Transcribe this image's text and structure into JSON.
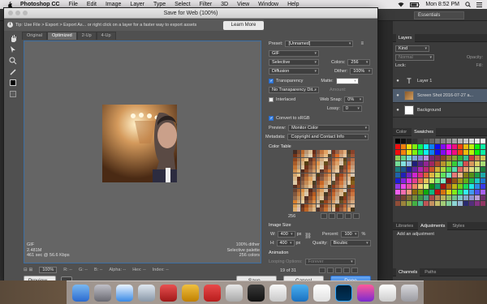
{
  "menubar": {
    "app": "Photoshop CC",
    "items": [
      "File",
      "Edit",
      "Image",
      "Layer",
      "Type",
      "Select",
      "Filter",
      "3D",
      "View",
      "Window",
      "Help"
    ],
    "clock": "Mon 8:52 PM",
    "icons": [
      "wifi-icon",
      "battery-icon",
      "search-icon",
      "menu-icon"
    ]
  },
  "workspace": {
    "essentials": "Essentials"
  },
  "layers_panel": {
    "tabs": [
      "Layers"
    ],
    "kind_label": "Kind",
    "blend": "Normal",
    "opacity_label": "Opacity:",
    "lock_label": "Lock:",
    "fill_label": "Fill:",
    "layers": [
      {
        "name": "Layer 1",
        "type": "text"
      },
      {
        "name": "Screen Shot 2016-07-27 a...",
        "type": "image"
      },
      {
        "name": "Background",
        "type": "bg"
      }
    ]
  },
  "color_panel": {
    "tabs": [
      "Color",
      "Swatches"
    ]
  },
  "adjust_panel": {
    "tabs": [
      "Libraries",
      "Adjustments",
      "Styles"
    ],
    "add_label": "Add an adjustment"
  },
  "channels_panel": {
    "tabs": [
      "Channels",
      "Paths"
    ]
  },
  "dialog": {
    "title": "Save for Web (100%)",
    "tip": "Tip: Use File > Export > Export As... or right click on a layer for a faster way to export assets",
    "learn_more": "Learn More",
    "view_tabs": [
      "Original",
      "Optimized",
      "2-Up",
      "4-Up"
    ],
    "active_tab": "Optimized",
    "info_left": [
      "GIF",
      "2.481M",
      "461 sec @ 56.6 Kbps"
    ],
    "info_right": [
      "100% dither",
      "Selective palette",
      "256 colors"
    ],
    "status": {
      "zoom": "100%",
      "r": "R: --",
      "g": "G: --",
      "b": "B: --",
      "alpha": "Alpha: --",
      "hex": "Hex: --",
      "index": "Index: --"
    },
    "buttons": {
      "preview": "Preview...",
      "save": "Save...",
      "cancel": "Cancel",
      "done": "Done"
    },
    "settings": {
      "preset_label": "Preset:",
      "preset_value": "[Unnamed]",
      "format": "GIF",
      "reduction": "Selective",
      "colors_label": "Colors:",
      "colors_value": "256",
      "dither_algo": "Diffusion",
      "dither_label": "Dither:",
      "dither_value": "100%",
      "transparency": "Transparency",
      "matte_label": "Matte:",
      "trans_dither": "No Transparency Dit...",
      "amount_label": "Amount:",
      "interlaced": "Interlaced",
      "websnap_label": "Web Snap:",
      "websnap_value": "0%",
      "lossy_label": "Lossy:",
      "lossy_value": "0",
      "convert_srgb": "Convert to sRGB",
      "preview_label": "Preview:",
      "preview_value": "Monitor Color",
      "metadata_label": "Metadata:",
      "metadata_value": "Copyright and Contact Info",
      "color_table": "Color Table",
      "color_count": "256",
      "image_size": "Image Size",
      "w_label": "W:",
      "w_value": "400",
      "h_label": "H:",
      "h_value": "400",
      "unit": "px",
      "percent_label": "Percent:",
      "percent_value": "100",
      "percent_unit": "%",
      "quality_label": "Quality:",
      "quality_value": "Bicubic",
      "animation": "Animation",
      "looping_label": "Looping Options:",
      "looping_value": "Forever",
      "frame": "19 of 31"
    }
  }
}
